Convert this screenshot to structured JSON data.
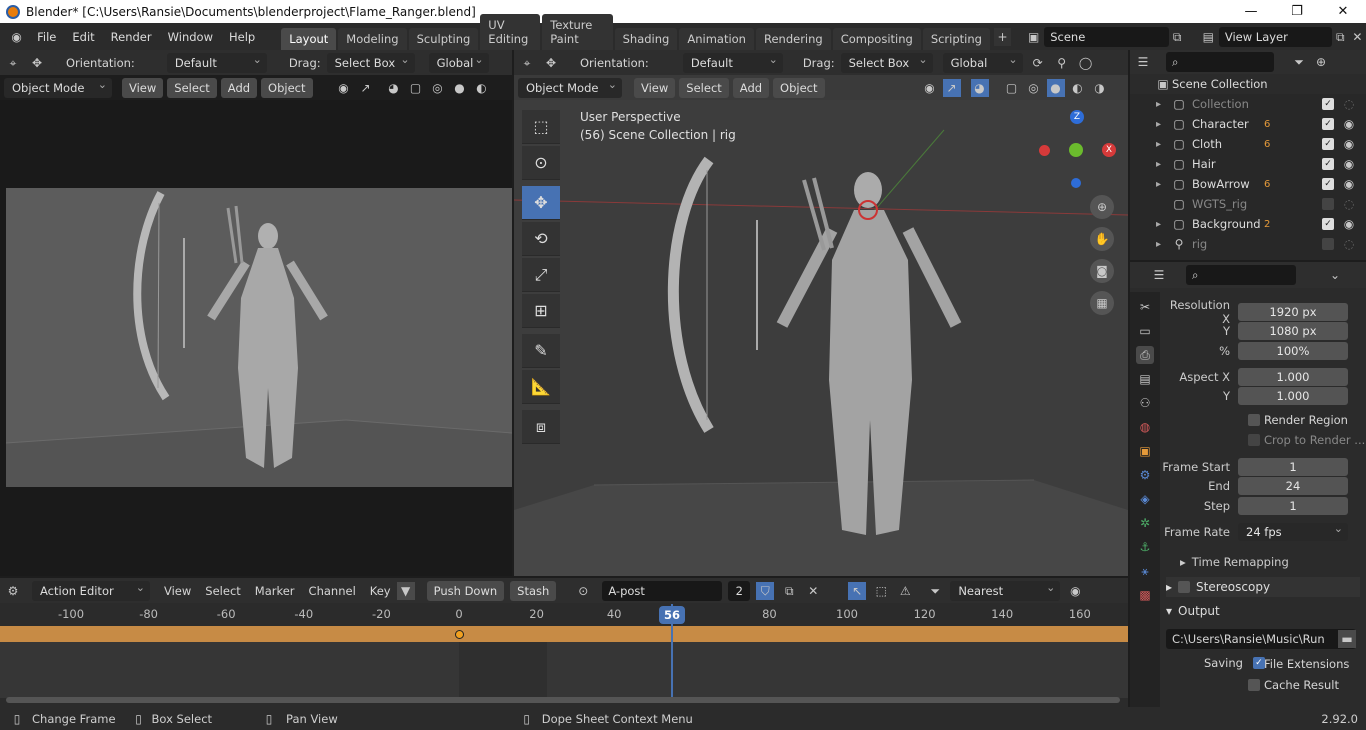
{
  "window": {
    "title": "Blender* [C:\\Users\\Ransie\\Documents\\blenderproject\\Flame_Ranger.blend]",
    "minimize": "—",
    "maximize": "❐",
    "close": "✕"
  },
  "menu": [
    "File",
    "Edit",
    "Render",
    "Window",
    "Help"
  ],
  "workspaces": [
    "Layout",
    "Modeling",
    "Sculpting",
    "UV Editing",
    "Texture Paint",
    "Shading",
    "Animation",
    "Rendering",
    "Compositing",
    "Scripting"
  ],
  "scene": {
    "name": "Scene",
    "view_layer": "View Layer"
  },
  "left_viewport": {
    "orientation_label": "Orientation:",
    "orientation_value": "Default",
    "drag_label": "Drag:",
    "drag_value": "Select Box",
    "transform": "Global",
    "mode": "Object Mode",
    "view": "View",
    "select": "Select",
    "add": "Add",
    "object": "Object"
  },
  "right_viewport": {
    "orientation_label": "Orientation:",
    "orientation_value": "Default",
    "drag_label": "Drag:",
    "drag_value": "Select Box",
    "transform": "Global",
    "mode": "Object Mode",
    "view": "View",
    "select": "Select",
    "add": "Add",
    "object": "Object",
    "info_line1": "User Perspective",
    "info_line2": "(56) Scene Collection | rig",
    "gizmo_z": "Z",
    "gizmo_x": "X"
  },
  "outliner": {
    "root": "Scene Collection",
    "items": [
      {
        "name": "Collection",
        "dim": true,
        "badge": "",
        "checked": true,
        "visible": false
      },
      {
        "name": "Character",
        "dim": false,
        "badge": "6",
        "checked": true,
        "visible": true
      },
      {
        "name": "Cloth",
        "dim": false,
        "badge": "6",
        "checked": true,
        "visible": true
      },
      {
        "name": "Hair",
        "dim": false,
        "badge": "",
        "checked": true,
        "visible": true
      },
      {
        "name": "BowArrow",
        "dim": false,
        "badge": "6",
        "checked": true,
        "visible": true
      },
      {
        "name": "WGTS_rig",
        "dim": true,
        "badge": "",
        "checked": false,
        "visible": false
      },
      {
        "name": "Background",
        "dim": false,
        "badge": "2",
        "checked": true,
        "visible": true
      },
      {
        "name": "rig",
        "dim": true,
        "badge": "",
        "checked": false,
        "visible": false
      }
    ]
  },
  "properties": {
    "resolution_x_label": "Resolution X",
    "resolution_x": "1920 px",
    "y_label": "Y",
    "resolution_y": "1080 px",
    "pct_label": "%",
    "pct": "100%",
    "aspect_x_label": "Aspect X",
    "aspect_x": "1.000",
    "aspect_y_label": "Y",
    "aspect_y": "1.000",
    "render_region": "Render Region",
    "crop": "Crop to Render ...",
    "frame_start_label": "Frame Start",
    "frame_start": "1",
    "end_label": "End",
    "frame_end": "24",
    "step_label": "Step",
    "frame_step": "1",
    "frame_rate_label": "Frame Rate",
    "frame_rate": "24 fps",
    "time_remapping": "Time Remapping",
    "stereoscopy": "Stereoscopy",
    "output": "Output",
    "output_path": "C:\\Users\\Ransie\\Music\\Run",
    "saving_label": "Saving",
    "file_extensions": "File Extensions",
    "cache_result": "Cache Result"
  },
  "timeline": {
    "editor": "Action Editor",
    "view": "View",
    "select": "Select",
    "marker": "Marker",
    "channel": "Channel",
    "key": "Key",
    "push_down": "Push Down",
    "stash": "Stash",
    "action": "A-post",
    "users": "2",
    "snap": "Nearest Frame",
    "ticks": [
      "-100",
      "-80",
      "-60",
      "-40",
      "-20",
      "0",
      "20",
      "40",
      "80",
      "100",
      "120",
      "140",
      "160"
    ],
    "current_frame": "56"
  },
  "status": {
    "change_frame": "Change Frame",
    "box_select": "Box Select",
    "pan_view": "Pan View",
    "context_menu": "Dope Sheet Context Menu",
    "version": "2.92.0"
  }
}
